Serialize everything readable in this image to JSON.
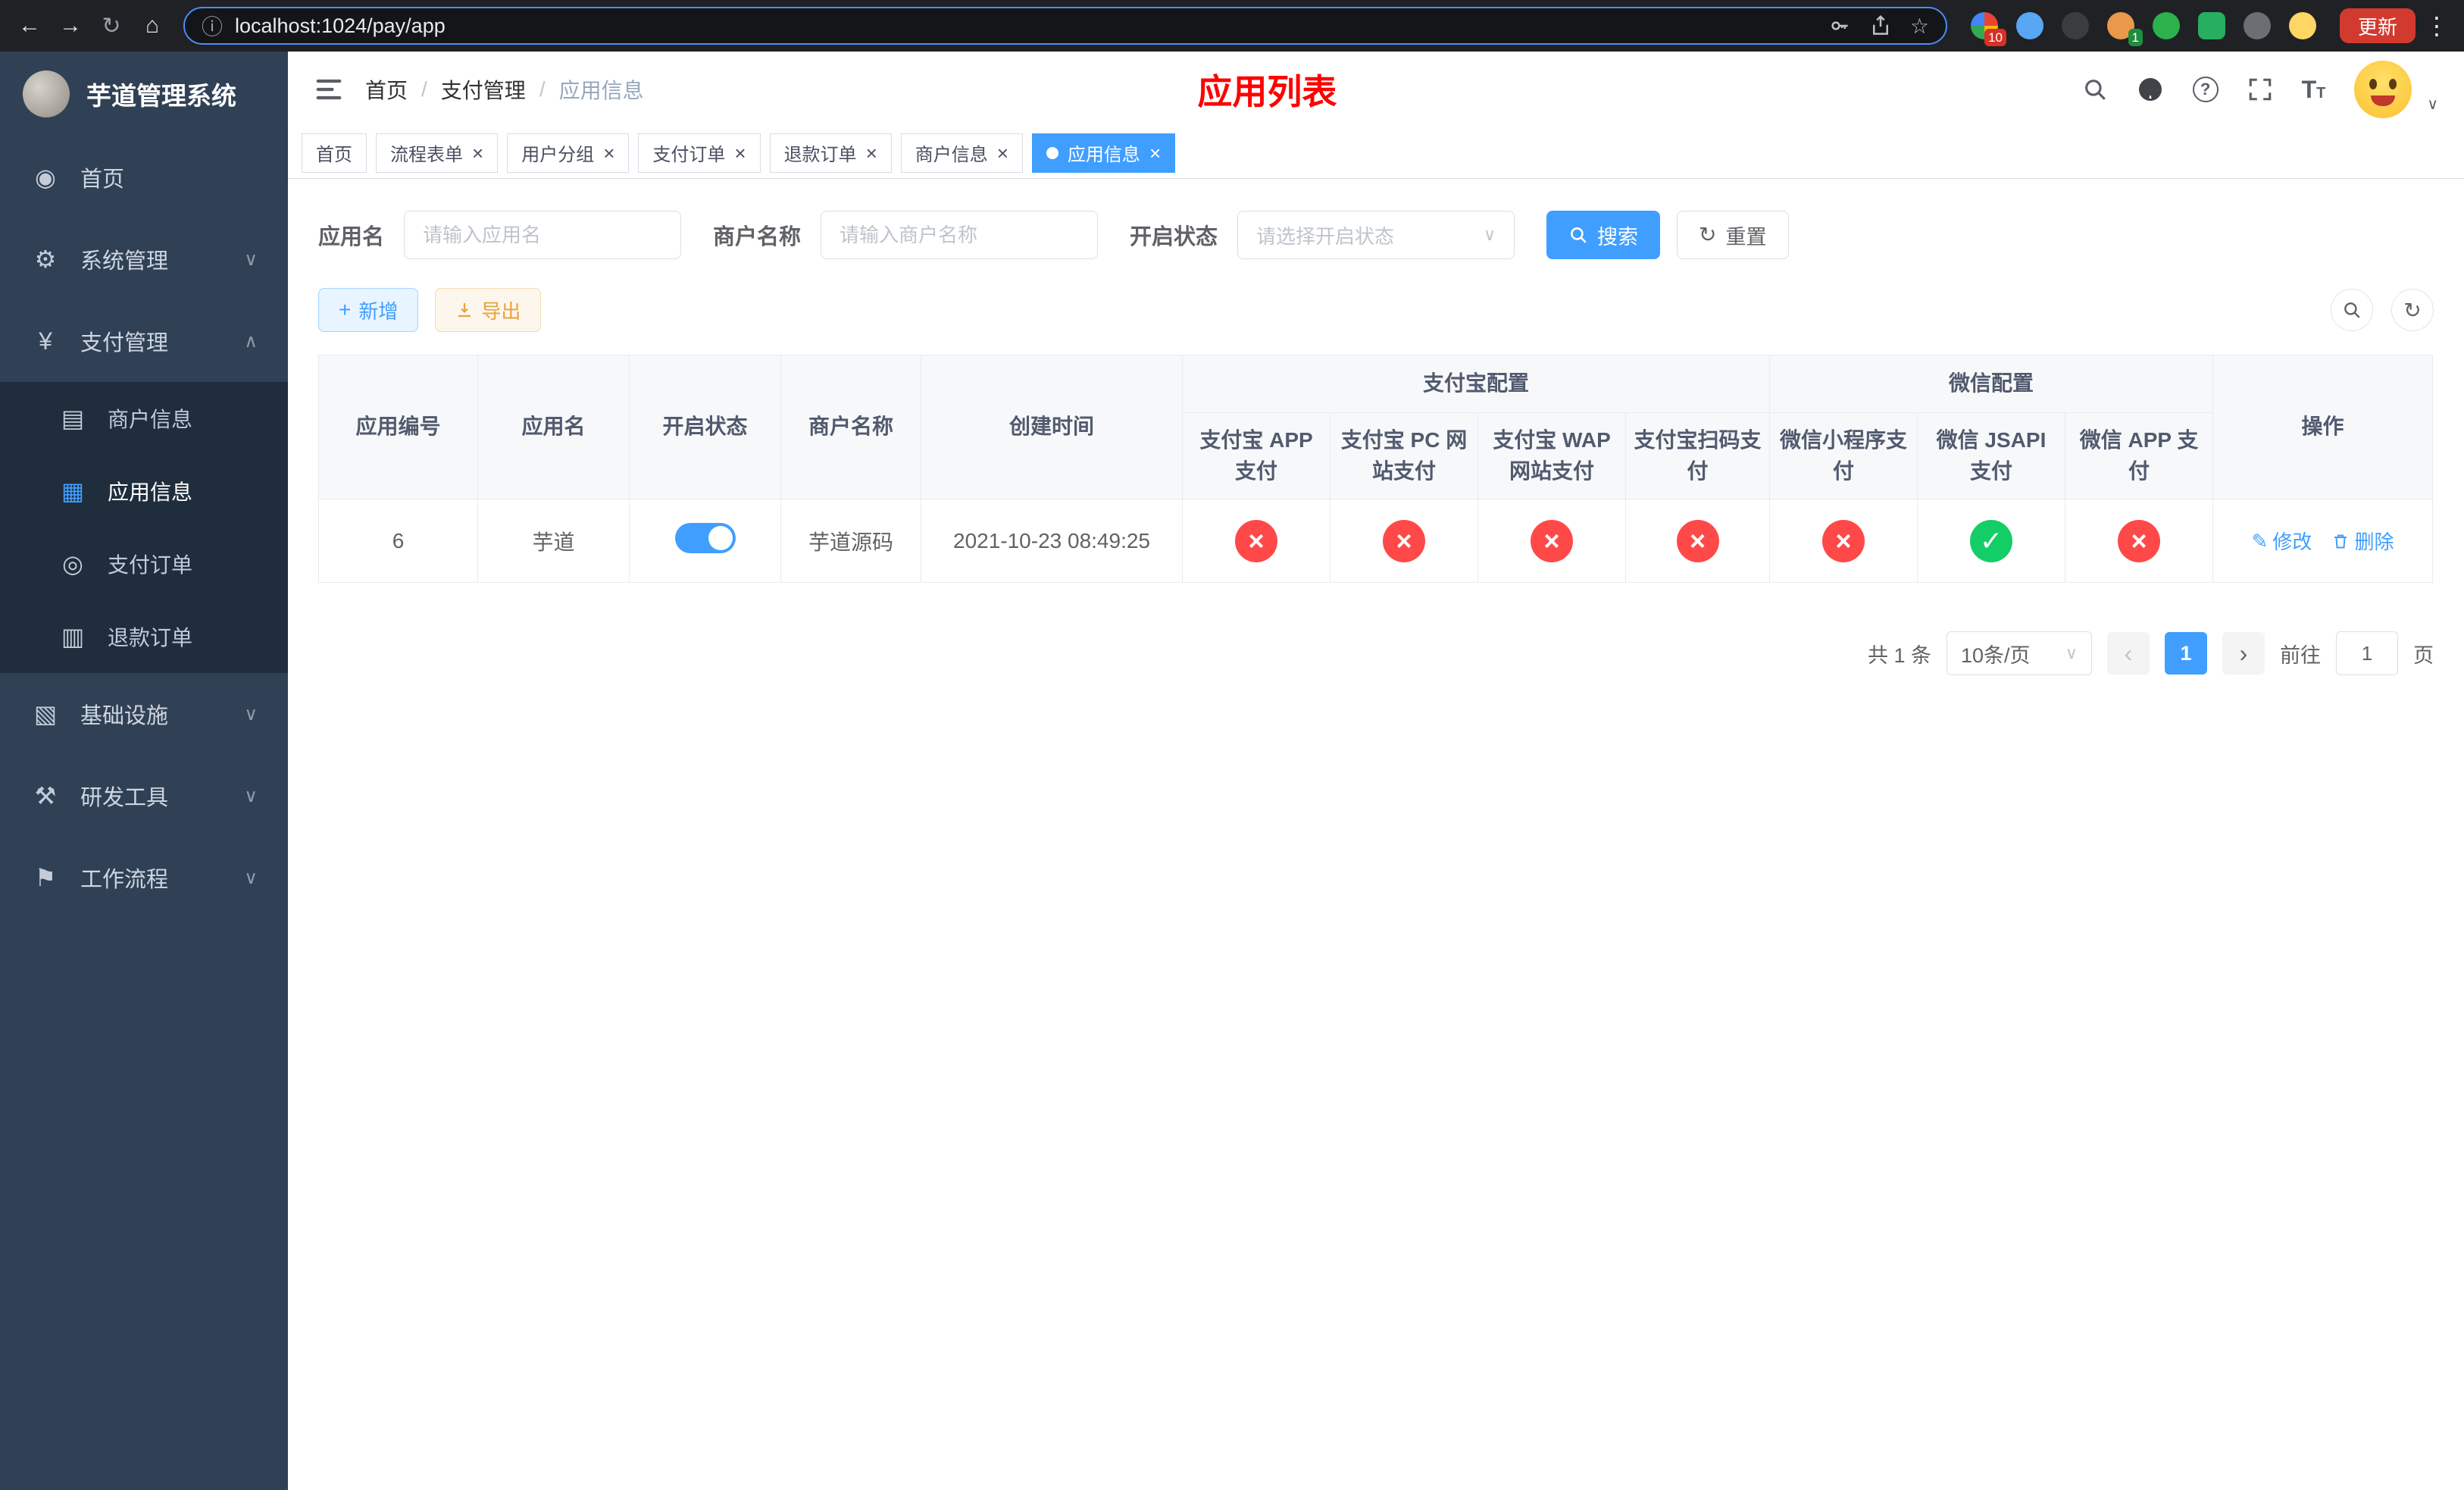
{
  "colors": {
    "accent": "#409eff",
    "danger": "#ff4949",
    "success": "#13ce66",
    "title_red": "#ff0000",
    "sidebar_bg": "#304156",
    "submenu_bg": "#1f2d3d"
  },
  "browser": {
    "url": "localhost:1024/pay/app",
    "update_label": "更新",
    "ext_badge_red": "10",
    "ext_badge_green": "1"
  },
  "icons": {
    "back": "←",
    "forward": "→",
    "reload": "↻",
    "home": "⌂",
    "info": "ⓘ",
    "star": "☆",
    "menu_dots": "⋮",
    "dashboard": "◉",
    "gear": "⚙",
    "yen": "¥",
    "merchant_card": "▤",
    "app_grid": "▦",
    "pay_order": "◎",
    "refund_doc": "▥",
    "infra": "▧",
    "tools": "⚒",
    "workflow": "⚑",
    "chevron_down": "∨",
    "chevron_up": "∧",
    "plus": "+",
    "edit": "✎",
    "refresh": "↻",
    "prev": "‹",
    "next": "›",
    "close": "×",
    "check": "✓",
    "help": "?",
    "font_size": "T"
  },
  "sidebar": {
    "logo_title": "芋道管理系统",
    "home": "首页",
    "system": "系统管理",
    "payment": "支付管理",
    "merchant_info": "商户信息",
    "app_info": "应用信息",
    "pay_order": "支付订单",
    "refund_order": "退款订单",
    "infra": "基础设施",
    "dev_tools": "研发工具",
    "workflow": "工作流程"
  },
  "header": {
    "crumb_home": "首页",
    "crumb_payment": "支付管理",
    "crumb_app": "应用信息",
    "separator": "/",
    "title": "应用列表"
  },
  "tabs": {
    "items": [
      "首页",
      "流程表单",
      "用户分组",
      "支付订单",
      "退款订单",
      "商户信息",
      "应用信息"
    ]
  },
  "filters": {
    "app_name_label": "应用名",
    "app_name_placeholder": "请输入应用名",
    "merchant_label": "商户名称",
    "merchant_placeholder": "请输入商户名称",
    "status_label": "开启状态",
    "status_placeholder": "请选择开启状态",
    "search_label": "搜索",
    "reset_label": "重置"
  },
  "toolbar": {
    "add_label": "新增",
    "export_label": "导出"
  },
  "table": {
    "col_app_id": "应用编号",
    "col_app_name": "应用名",
    "col_status": "开启状态",
    "col_merchant": "商户名称",
    "col_created": "创建时间",
    "group_alipay": "支付宝配置",
    "group_wechat": "微信配置",
    "col_alipay_app": "支付宝 APP 支付",
    "col_alipay_pc": "支付宝 PC 网站支付",
    "col_alipay_wap": "支付宝 WAP 网站支付",
    "col_alipay_qr": "支付宝扫码支付",
    "col_wx_mini": "微信小程序支付",
    "col_wx_jsapi": "微信 JSAPI 支付",
    "col_wx_app": "微信 APP 支付",
    "col_actions": "操作",
    "rows": [
      {
        "id": "6",
        "name": "芋道",
        "enabled": true,
        "merchant": "芋道源码",
        "created": "2021-10-23 08:49:25",
        "alipay_app": false,
        "alipay_pc": false,
        "alipay_wap": false,
        "alipay_qr": false,
        "wx_mini": false,
        "wx_jsapi": true,
        "wx_app": false,
        "edit_label": "修改",
        "delete_label": "删除"
      }
    ]
  },
  "pagination": {
    "total_text": "共 1 条",
    "page_size_text": "10条/页",
    "page": "1",
    "goto_prefix": "前往",
    "goto_value": "1",
    "goto_suffix": "页"
  }
}
